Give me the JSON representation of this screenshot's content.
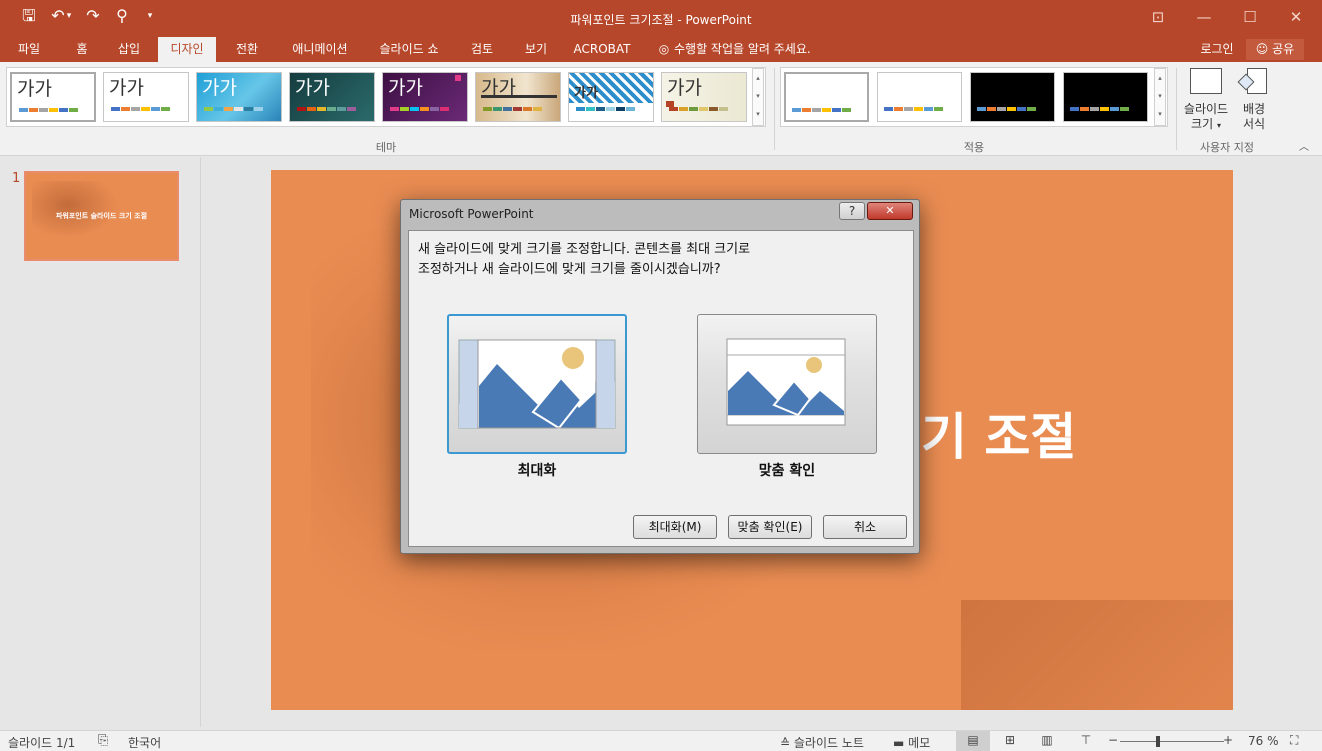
{
  "window": {
    "title": "파워포인트 크기조절 - PowerPoint",
    "controls": {
      "ribbon_display": "⊡",
      "minimize": "—",
      "maximize": "☐",
      "close": "✕"
    }
  },
  "qat": {
    "save": "🖫",
    "undo": "↶",
    "undo_arrow": "▾",
    "redo": "↷",
    "present": "⚲",
    "customize": "▾"
  },
  "tabs": [
    "파일",
    "홈",
    "삽입",
    "디자인",
    "전환",
    "애니메이션",
    "슬라이드 쇼",
    "검토",
    "보기",
    "ACROBAT"
  ],
  "active_tab": "디자인",
  "tell_me": "수행할 작업을 알려 주세요.",
  "signin": "로그인",
  "share": "공유",
  "ribbon": {
    "theme_sample": "가가",
    "group_themes": "테마",
    "group_variants": "적용",
    "group_customize": "사용자 지정",
    "slide_size_label_1": "슬라이드",
    "slide_size_label_2": "크기",
    "format_bg_label_1": "배경",
    "format_bg_label_2": "서식"
  },
  "thumbnails": [
    {
      "number": "1",
      "title": "파워포인트 슬라이드 크기 조절"
    }
  ],
  "slide": {
    "visible_title": "기 조절"
  },
  "dialog": {
    "title": "Microsoft PowerPoint",
    "help": "?",
    "close": "✕",
    "message_line1": "새 슬라이드에 맞게 크기를 조정합니다. 콘텐츠를 최대 크기로",
    "message_line2": "조정하거나 새 슬라이드에 맞게 크기를 줄이시겠습니까?",
    "option_maximize": "최대화",
    "option_fit": "맞춤 확인",
    "btn_maximize": "최대화(M)",
    "btn_fit": "맞춤 확인(E)",
    "btn_cancel": "취소"
  },
  "status": {
    "slide_count": "슬라이드 1/1",
    "language": "한국어",
    "notes": "슬라이드 노트",
    "comments": "메모",
    "zoom_minus": "−",
    "zoom_plus": "+",
    "zoom_level": "76 %",
    "zoom_fraction": 0.76
  },
  "colors": {
    "accent": "#b7472a",
    "slide_bg": "#e98c52",
    "selected_border": "#3c98d0"
  }
}
